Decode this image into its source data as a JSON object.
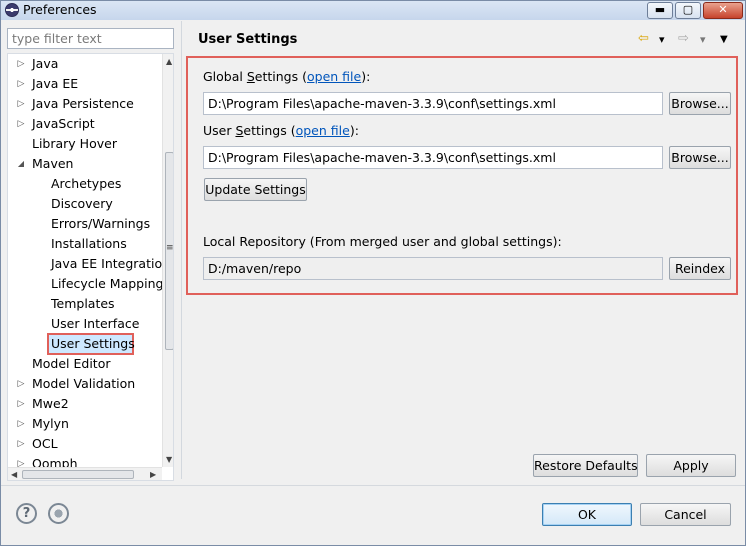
{
  "window": {
    "title": "Preferences"
  },
  "titlebar": {
    "minimize": "▬",
    "maximize": "▢",
    "close": "✕"
  },
  "filter": {
    "placeholder": "type filter text"
  },
  "tree": {
    "items": [
      {
        "label": "Java",
        "expander": "▷"
      },
      {
        "label": "Java EE",
        "expander": "▷"
      },
      {
        "label": "Java Persistence",
        "expander": "▷"
      },
      {
        "label": "JavaScript",
        "expander": "▷"
      },
      {
        "label": "Library Hover",
        "expander": ""
      },
      {
        "label": "Maven",
        "expander": "◢"
      },
      {
        "label": "Archetypes",
        "expander": ""
      },
      {
        "label": "Discovery",
        "expander": ""
      },
      {
        "label": "Errors/Warnings",
        "expander": ""
      },
      {
        "label": "Installations",
        "expander": ""
      },
      {
        "label": "Java EE Integration",
        "expander": ""
      },
      {
        "label": "Lifecycle Mapping",
        "expander": ""
      },
      {
        "label": "Templates",
        "expander": ""
      },
      {
        "label": "User Interface",
        "expander": ""
      },
      {
        "label": "User Settings",
        "expander": ""
      },
      {
        "label": "Model Editor",
        "expander": ""
      },
      {
        "label": "Model Validation",
        "expander": "▷"
      },
      {
        "label": "Mwe2",
        "expander": "▷"
      },
      {
        "label": "Mylyn",
        "expander": "▷"
      },
      {
        "label": "OCL",
        "expander": "▷"
      },
      {
        "label": "Oomph",
        "expander": "▷"
      }
    ],
    "scroll_up": "▲",
    "scroll_down": "▼",
    "scroll_left": "◀",
    "scroll_right": "▶",
    "grip": "≡"
  },
  "page": {
    "title": "User Settings",
    "nav": {
      "back": "⇦",
      "back_menu": "▾",
      "forward": "⇨",
      "forward_menu": "▾",
      "view_menu": "▼"
    },
    "global": {
      "label_prefix": "Global ",
      "label_mnemonic": "S",
      "label_rest": "ettings (",
      "link": "open file",
      "label_suffix": "):",
      "path": "D:\\Program Files\\apache-maven-3.3.9\\conf\\settings.xml",
      "browse": "Browse..."
    },
    "user": {
      "label_prefix": "User ",
      "label_mnemonic": "S",
      "label_rest": "ettings (",
      "link": "open file",
      "label_suffix": "):",
      "path": "D:\\Program Files\\apache-maven-3.3.9\\conf\\settings.xml",
      "browse": "Browse..."
    },
    "update_button": "Update Settings",
    "local_repo": {
      "label": "Local Repository (From merged user and global settings):",
      "path": "D:/maven/repo",
      "reindex": "Reindex"
    },
    "restore_defaults": "Restore Defaults",
    "apply": "Apply"
  },
  "footer": {
    "help": "?",
    "ok": "OK",
    "cancel": "Cancel"
  },
  "colors": {
    "highlight_border": "#e0605a",
    "link": "#0055bb",
    "selection": "#cde8ff"
  }
}
